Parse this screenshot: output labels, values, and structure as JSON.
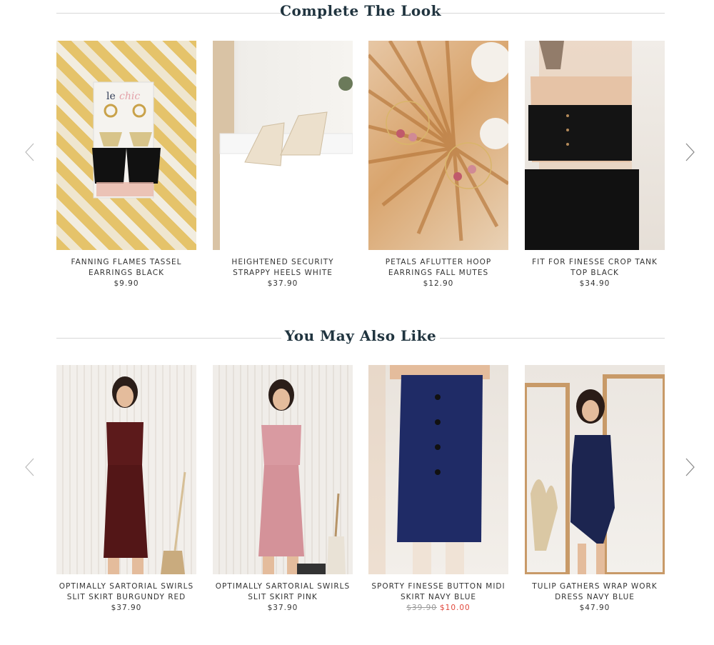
{
  "complete_the_look": {
    "title": "Complete The Look",
    "products": [
      {
        "name": "FANNING FLAMES TASSEL EARRINGS BLACK",
        "price": "$9.90",
        "image_alt": "earrings"
      },
      {
        "name": "HEIGHTENED SECURITY STRAPPY HEELS WHITE",
        "price": "$37.90",
        "image_alt": "heels"
      },
      {
        "name": "PETALS AFLUTTER HOOP EARRINGS FALL MUTES",
        "price": "$12.90",
        "image_alt": "hoop earrings"
      },
      {
        "name": "FIT FOR FINESSE CROP TANK TOP BLACK",
        "price": "$34.90",
        "image_alt": "crop top"
      }
    ]
  },
  "you_may_also_like": {
    "title": "You May Also Like",
    "products": [
      {
        "name": "OPTIMALLY SARTORIAL SWIRLS SLIT SKIRT BURGUNDY RED",
        "price": "$37.90",
        "image_alt": "burgundy skirt"
      },
      {
        "name": "OPTIMALLY SARTORIAL SWIRLS SLIT SKIRT PINK",
        "price": "$37.90",
        "image_alt": "pink skirt"
      },
      {
        "name": "SPORTY FINESSE BUTTON MIDI SKIRT NAVY BLUE",
        "original_price": "$39.90",
        "sale_price": "$10.00",
        "image_alt": "navy skirt"
      },
      {
        "name": "TULIP GATHERS WRAP WORK DRESS NAVY BLUE",
        "price": "$47.90",
        "image_alt": "navy dress"
      }
    ]
  },
  "icons": {
    "prev": "chevron-left-icon",
    "next": "chevron-right-icon"
  },
  "colors": {
    "heading": "#20343f",
    "sale": "#e0473b",
    "divider": "#d8d8d8"
  }
}
